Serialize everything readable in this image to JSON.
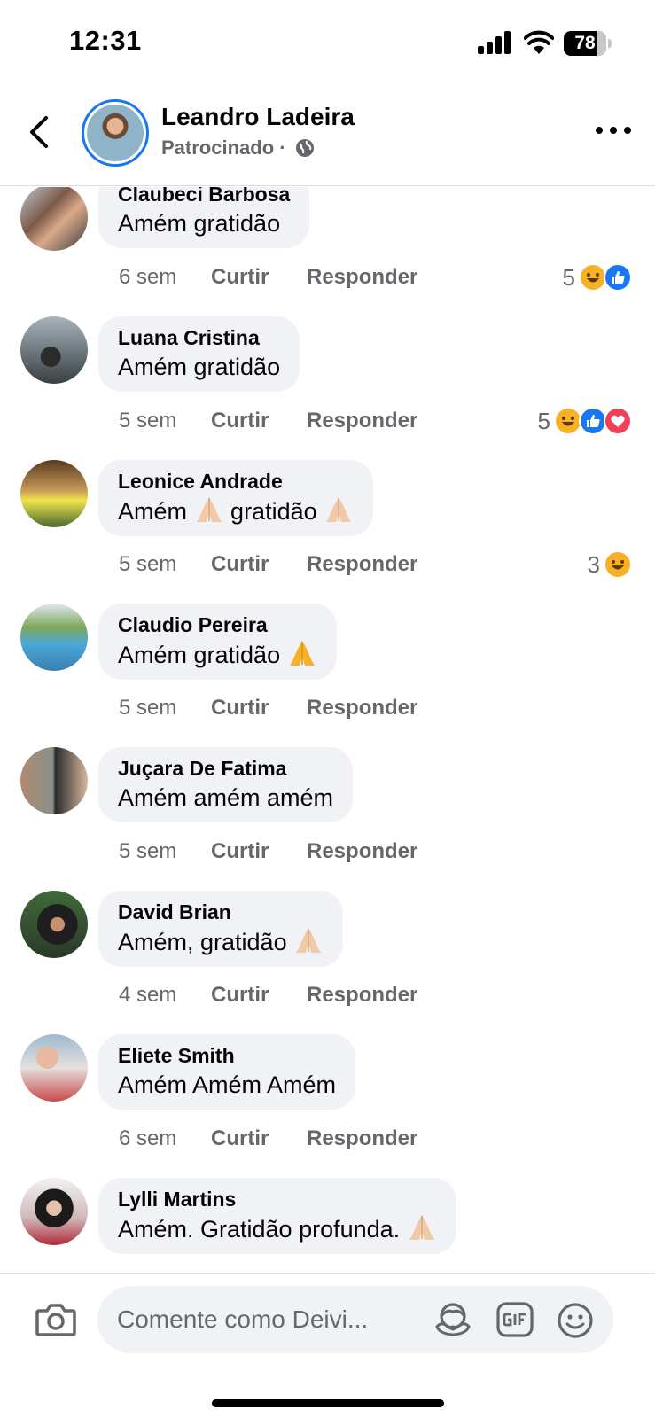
{
  "status_bar": {
    "time": "12:31",
    "battery_percent": "78",
    "battery_level": 0.78
  },
  "header": {
    "name": "Leandro Ladeira",
    "subtitle": "Patrocinado ·",
    "icons": [
      "back-icon",
      "globe-icon",
      "more-icon"
    ]
  },
  "comments": [
    {
      "name": "Claubeci Barbosa",
      "text": "Amém gratidão",
      "emojis": [],
      "time": "6 sem",
      "like": "Curtir",
      "reply": "Responder",
      "reaction_count": "5",
      "reactions": [
        "haha",
        "like"
      ]
    },
    {
      "name": "Luana Cristina",
      "text": "Amém gratidão",
      "emojis": [],
      "time": "5 sem",
      "like": "Curtir",
      "reply": "Responder",
      "reaction_count": "5",
      "reactions": [
        "haha",
        "like",
        "love"
      ]
    },
    {
      "name": "Leonice Andrade",
      "text_parts": [
        "Amém",
        "gratidão"
      ],
      "emojis": [
        "pray",
        "pray"
      ],
      "time": "5 sem",
      "like": "Curtir",
      "reply": "Responder",
      "reaction_count": "3",
      "reactions": [
        "haha"
      ]
    },
    {
      "name": "Claudio Pereira",
      "text": "Amém gratidão",
      "emojis": [
        "pray"
      ],
      "time": "5 sem",
      "like": "Curtir",
      "reply": "Responder",
      "reaction_count": "",
      "reactions": []
    },
    {
      "name": "Juçara De Fatima",
      "text": "Amém amém amém",
      "emojis": [],
      "time": "5 sem",
      "like": "Curtir",
      "reply": "Responder",
      "reaction_count": "",
      "reactions": []
    },
    {
      "name": "David Brian",
      "text": "Amém, gratidão",
      "emojis": [
        "pray"
      ],
      "time": "4 sem",
      "like": "Curtir",
      "reply": "Responder",
      "reaction_count": "",
      "reactions": []
    },
    {
      "name": "Eliete Smith",
      "text": "Amém Amém Amém",
      "emojis": [],
      "time": "6 sem",
      "like": "Curtir",
      "reply": "Responder",
      "reaction_count": "",
      "reactions": []
    },
    {
      "name": "Lylli Martins",
      "text": "Amém. Gratidão profunda.",
      "emojis": [
        "pray"
      ],
      "time": "",
      "like": "",
      "reply": "",
      "reaction_count": "",
      "reactions": []
    }
  ],
  "composer": {
    "placeholder": "Comente como Deivi...",
    "icons": [
      "camera-icon",
      "avatar-sticker-icon",
      "gif-icon",
      "sticker-icon"
    ]
  },
  "colors": {
    "accent": "#1877f2",
    "bubble": "#f0f2f5",
    "muted_text": "#65676b",
    "haha": "#f7b125",
    "love": "#f33e58"
  }
}
